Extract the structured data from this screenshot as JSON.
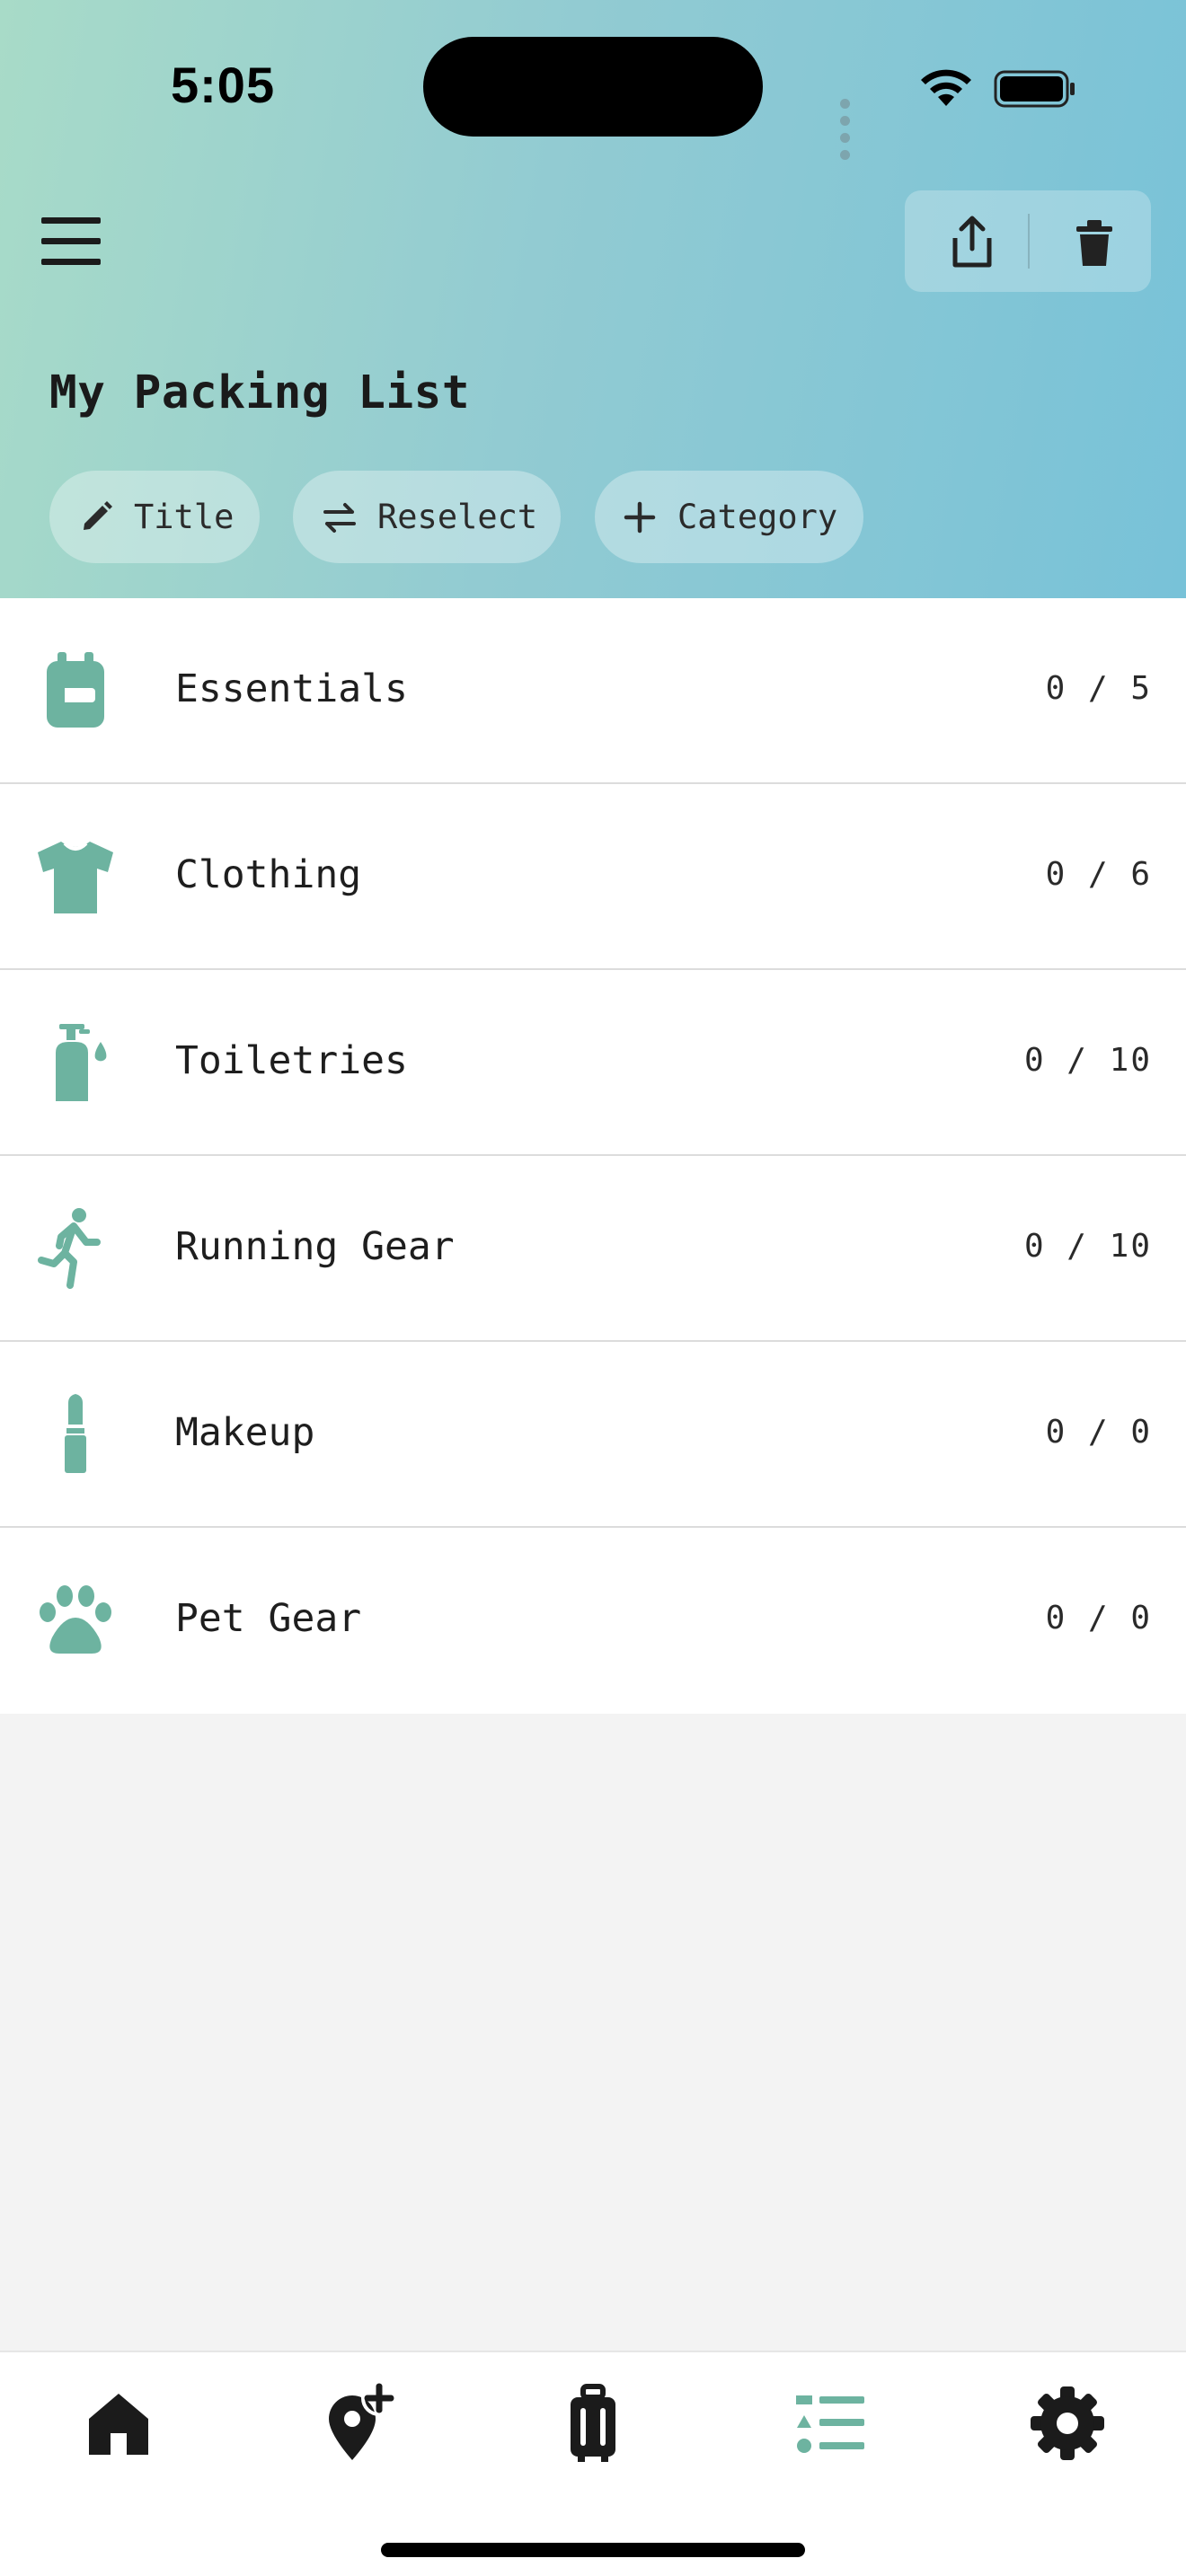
{
  "status_bar": {
    "time": "5:05"
  },
  "header": {
    "title": "My Packing List",
    "chips": {
      "title_label": "Title",
      "reselect_label": "Reselect",
      "category_label": "Category"
    }
  },
  "categories": [
    {
      "name": "Essentials",
      "count": "0 / 5",
      "icon": "backpack-icon"
    },
    {
      "name": "Clothing",
      "count": "0 / 6",
      "icon": "tshirt-icon"
    },
    {
      "name": "Toiletries",
      "count": "0 / 10",
      "icon": "soap-bottle-icon"
    },
    {
      "name": "Running Gear",
      "count": "0 / 10",
      "icon": "runner-icon"
    },
    {
      "name": "Makeup",
      "count": "0 / 0",
      "icon": "lipstick-icon"
    },
    {
      "name": "Pet Gear",
      "count": "0 / 0",
      "icon": "paw-icon"
    }
  ],
  "bottom_nav": [
    {
      "icon": "home-icon",
      "active": false
    },
    {
      "icon": "add-location-icon",
      "active": false
    },
    {
      "icon": "luggage-icon",
      "active": false
    },
    {
      "icon": "checklist-icon",
      "active": true
    },
    {
      "icon": "settings-icon",
      "active": false
    }
  ],
  "colors": {
    "accent": "#6db3a0",
    "header_gradient_start": "#a8dbc8",
    "header_gradient_end": "#78c2d8",
    "background": "#f3f3f3"
  }
}
